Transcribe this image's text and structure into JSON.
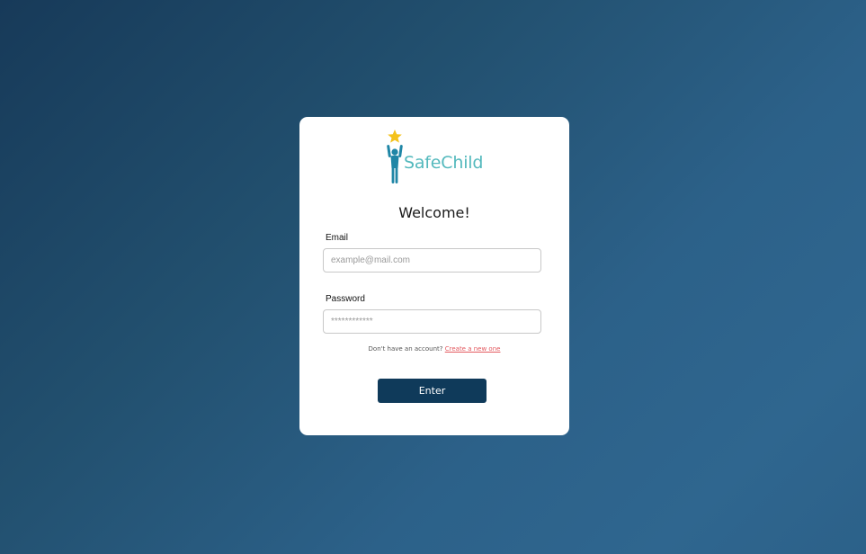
{
  "brand": {
    "name": "SafeChild",
    "logo_icon": "child-reaching-star-icon",
    "star_color": "#f4c21b",
    "figure_color": "#1f86a6",
    "text_color": "#54b9bd"
  },
  "login": {
    "title": "Welcome!",
    "email_label": "Email",
    "email_placeholder": "example@mail.com",
    "password_label": "Password",
    "password_placeholder": "************",
    "signup_prompt": "Don't have an account?",
    "signup_link": "Create a new one",
    "submit_label": "Enter"
  },
  "colors": {
    "button": "#0f3a5a",
    "link": "#e3595f"
  }
}
